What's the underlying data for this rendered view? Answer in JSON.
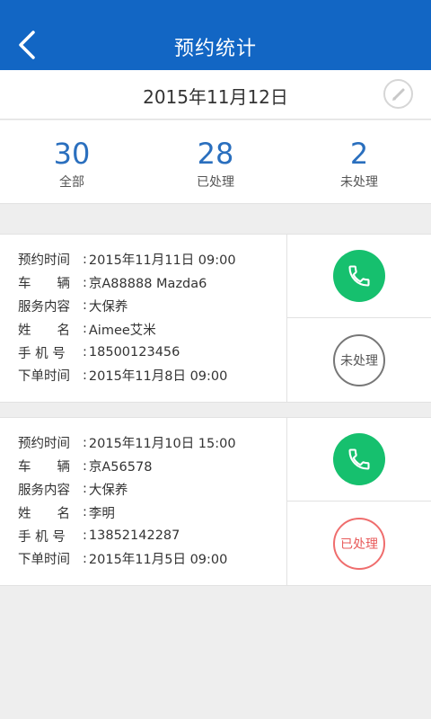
{
  "header": {
    "title": "预约统计"
  },
  "date": {
    "value": "2015年11月12日"
  },
  "stats": [
    {
      "count": "30",
      "label": "全部"
    },
    {
      "count": "28",
      "label": "已处理"
    },
    {
      "count": "2",
      "label": "未处理"
    }
  ],
  "labels": {
    "time": "预约时间",
    "vehicle": "车　　辆",
    "service": "服务内容",
    "name": "姓　　名",
    "phone": "手 机 号",
    "order": "下单时间"
  },
  "appointments": [
    {
      "time": "2015年11月11日 09:00",
      "vehicle": "京A88888 Mazda6",
      "service": "大保养",
      "name": "Aimee艾米",
      "phone": "18500123456",
      "order": "2015年11月8日 09:00",
      "status": "未处理"
    },
    {
      "time": "2015年11月10日 15:00",
      "vehicle": "京A56578",
      "service": "大保养",
      "name": "李明",
      "phone": "13852142287",
      "order": "2015年11月5日 09:00",
      "status": "已处理"
    }
  ],
  "colors": {
    "navbar": "#1266c4",
    "call": "#16c06e",
    "accent_number": "#2a6fbe",
    "done": "#e85a5a"
  },
  "icons": {
    "back": "chevron-left-icon",
    "edit": "pencil-icon",
    "call": "phone-icon"
  }
}
